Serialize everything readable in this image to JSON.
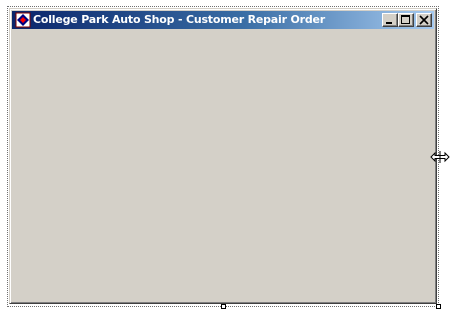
{
  "window": {
    "title": "College Park Auto Shop - Customer Repair Order",
    "app_icon": "vb-form-icon",
    "buttons": {
      "minimize": "minimize-icon",
      "maximize": "maximize-icon",
      "close": "close-icon"
    }
  },
  "designer": {
    "cursor": "horizontal-resize-cursor-icon"
  },
  "colors": {
    "title_active_start": "#0a246a",
    "title_active_end": "#a6caf0",
    "face": "#d4d0c8"
  }
}
